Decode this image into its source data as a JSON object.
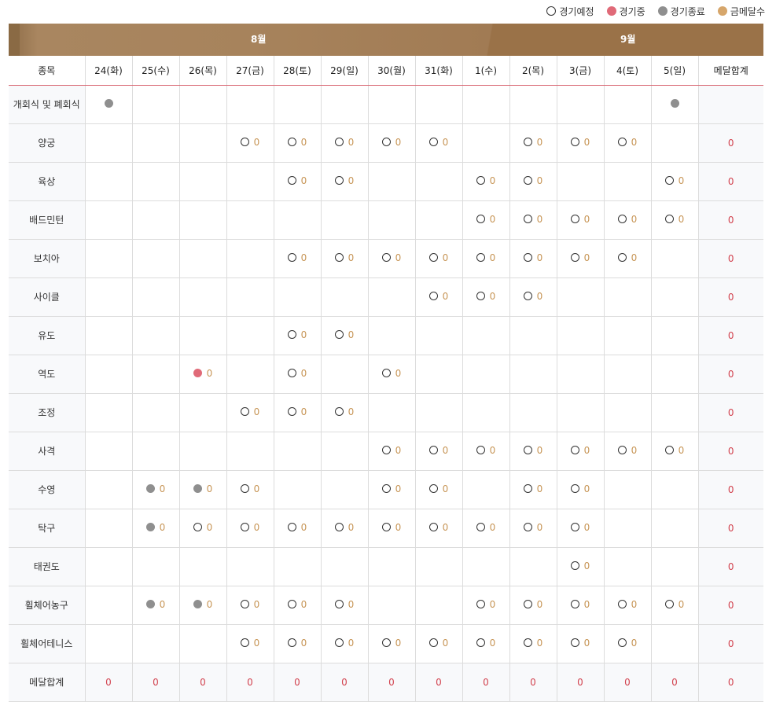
{
  "legend": [
    {
      "label": "경기예정",
      "status": "sched"
    },
    {
      "label": "경기중",
      "status": "live"
    },
    {
      "label": "경기종료",
      "status": "done"
    },
    {
      "label": "금메달수",
      "status": "gold"
    }
  ],
  "colors": {
    "scheduled": "#333333",
    "live": "#e06a78",
    "finished": "#8f8f8f",
    "gold": "#d6a66b",
    "accent": "#d2434f",
    "month_bar": "#a7835c"
  },
  "months": {
    "aug": "8월",
    "sep": "9월"
  },
  "headers": [
    "종목",
    "24(화)",
    "25(수)",
    "26(목)",
    "27(금)",
    "28(토)",
    "29(일)",
    "30(월)",
    "31(화)",
    "1(수)",
    "2(목)",
    "3(금)",
    "4(토)",
    "5(일)",
    "메달합계"
  ],
  "rows": [
    {
      "sport": "개회식 및 폐회식",
      "cells": [
        "d",
        "",
        "",
        "",
        "",
        "",
        "",
        "",
        "",
        "",
        "",
        "",
        "d"
      ],
      "total": ""
    },
    {
      "sport": "양궁",
      "cells": [
        "",
        "",
        "",
        "s0",
        "s0",
        "s0",
        "s0",
        "s0",
        "",
        "s0",
        "s0",
        "s0",
        ""
      ],
      "total": "0"
    },
    {
      "sport": "육상",
      "cells": [
        "",
        "",
        "",
        "",
        "s0",
        "s0",
        "",
        "",
        "s0",
        "s0",
        "",
        "",
        "s0"
      ],
      "total": "0"
    },
    {
      "sport": "배드민턴",
      "cells": [
        "",
        "",
        "",
        "",
        "",
        "",
        "",
        "",
        "s0",
        "s0",
        "s0",
        "s0",
        "s0"
      ],
      "total": "0"
    },
    {
      "sport": "보치아",
      "cells": [
        "",
        "",
        "",
        "",
        "s0",
        "s0",
        "s0",
        "s0",
        "s0",
        "s0",
        "s0",
        "s0",
        ""
      ],
      "total": "0"
    },
    {
      "sport": "사이클",
      "cells": [
        "",
        "",
        "",
        "",
        "",
        "",
        "",
        "s0",
        "s0",
        "s0",
        "",
        "",
        ""
      ],
      "total": "0"
    },
    {
      "sport": "유도",
      "cells": [
        "",
        "",
        "",
        "",
        "s0",
        "s0",
        "",
        "",
        "",
        "",
        "",
        "",
        ""
      ],
      "total": "0"
    },
    {
      "sport": "역도",
      "cells": [
        "",
        "",
        "l0",
        "",
        "s0",
        "",
        "s0",
        "",
        "",
        "",
        "",
        "",
        ""
      ],
      "total": "0"
    },
    {
      "sport": "조정",
      "cells": [
        "",
        "",
        "",
        "s0",
        "s0",
        "s0",
        "",
        "",
        "",
        "",
        "",
        "",
        ""
      ],
      "total": "0"
    },
    {
      "sport": "사격",
      "cells": [
        "",
        "",
        "",
        "",
        "",
        "",
        "s0",
        "s0",
        "s0",
        "s0",
        "s0",
        "s0",
        "s0"
      ],
      "total": "0"
    },
    {
      "sport": "수영",
      "cells": [
        "",
        "d0",
        "d0",
        "s0",
        "",
        "",
        "s0",
        "s0",
        "",
        "s0",
        "s0",
        "",
        ""
      ],
      "total": "0"
    },
    {
      "sport": "탁구",
      "cells": [
        "",
        "d0",
        "s0",
        "s0",
        "s0",
        "s0",
        "s0",
        "s0",
        "s0",
        "s0",
        "s0",
        "",
        ""
      ],
      "total": "0"
    },
    {
      "sport": "태권도",
      "cells": [
        "",
        "",
        "",
        "",
        "",
        "",
        "",
        "",
        "",
        "",
        "s0",
        "",
        ""
      ],
      "total": "0"
    },
    {
      "sport": "휠체어농구",
      "cells": [
        "",
        "d0",
        "d0",
        "s0",
        "s0",
        "s0",
        "",
        "",
        "s0",
        "s0",
        "s0",
        "s0",
        "s0"
      ],
      "total": "0"
    },
    {
      "sport": "휠체어테니스",
      "cells": [
        "",
        "",
        "",
        "s0",
        "s0",
        "s0",
        "s0",
        "s0",
        "s0",
        "s0",
        "s0",
        "s0",
        ""
      ],
      "total": "0"
    }
  ],
  "summary": {
    "label": "메달합계",
    "values": [
      "0",
      "0",
      "0",
      "0",
      "0",
      "0",
      "0",
      "0",
      "0",
      "0",
      "0",
      "0",
      "0",
      "0"
    ]
  }
}
